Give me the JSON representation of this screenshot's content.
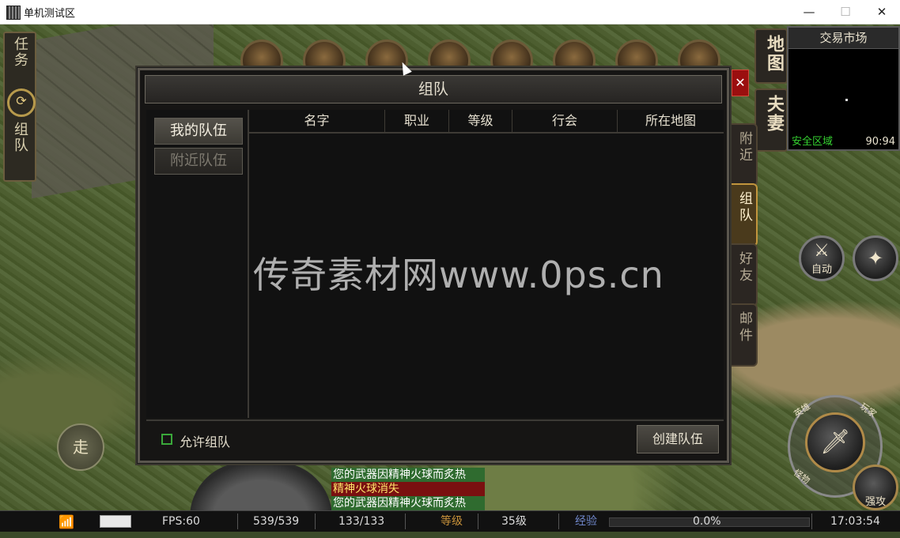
{
  "window": {
    "title": "单机测试区",
    "min_label": "—",
    "max_label": "☐",
    "close_label": "✕"
  },
  "left_panel": {
    "task_label": "任务",
    "team_label": "组队",
    "swap_glyph": "⟳"
  },
  "right_panel": {
    "map_label": "地图",
    "spouse_label": "夫妻"
  },
  "minimap": {
    "title": "交易市场",
    "zone": "安全区域",
    "coords": "90:94"
  },
  "side_tabs": [
    {
      "label": "附近",
      "active": false
    },
    {
      "label": "组队",
      "active": true
    },
    {
      "label": "好友",
      "active": false
    },
    {
      "label": "邮件",
      "active": false
    }
  ],
  "dialog": {
    "title": "组队",
    "close_glyph": "✕",
    "tabs": {
      "my_team": "我的队伍",
      "nearby_team": "附近队伍"
    },
    "columns": [
      "名字",
      "职业",
      "等级",
      "行会",
      "所在地图"
    ],
    "rows": [],
    "allow_team_label": "允许组队",
    "create_button": "创建队伍"
  },
  "watermark": "传奇素材网www.0ps.cn",
  "buttons": {
    "auto": "自动",
    "walk": "走",
    "attack_tr": "玩家",
    "attack_tl": "英雄",
    "attack_bl": "怪物",
    "strong": "强攻"
  },
  "chat": [
    {
      "text": "您的武器因精神火球而炙热",
      "color": "#ffffff",
      "bg": "#2f6b2f"
    },
    {
      "text": "精神火球消失",
      "color": "#ffe36a",
      "bg": "#7a1010"
    },
    {
      "text": "您的武器因精神火球而炙热",
      "color": "#ffffff",
      "bg": "#2f6b2f"
    }
  ],
  "hud": {
    "fps": "FPS:60",
    "hp": "539/539",
    "mp": "133/133",
    "level_label": "等级",
    "level": "35级",
    "exp_label": "经验",
    "exp_percent": "0.0%",
    "time": "17:03:54"
  }
}
